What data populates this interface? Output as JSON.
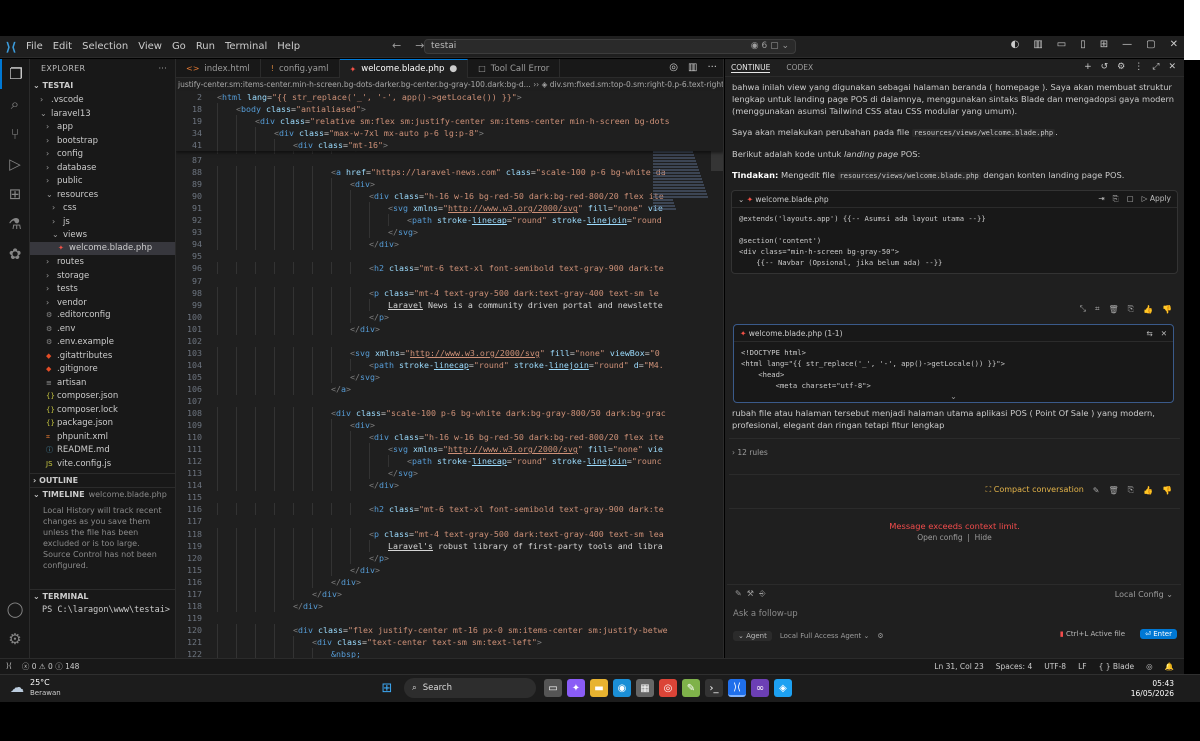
{
  "titlebar": {
    "menu": [
      "File",
      "Edit",
      "Selection",
      "View",
      "Go",
      "Run",
      "Terminal",
      "Help"
    ],
    "search": "testai",
    "badge": "6"
  },
  "sidebar": {
    "header": "EXPLORER",
    "project": "TESTAI",
    "tree": [
      {
        "label": ".vscode",
        "type": "folder",
        "depth": 1,
        "open": false
      },
      {
        "label": "laravel13",
        "type": "folder",
        "depth": 1,
        "open": true
      },
      {
        "label": "app",
        "type": "folder",
        "depth": 2,
        "open": false
      },
      {
        "label": "bootstrap",
        "type": "folder",
        "depth": 2,
        "open": false
      },
      {
        "label": "config",
        "type": "folder",
        "depth": 2,
        "open": false
      },
      {
        "label": "database",
        "type": "folder",
        "depth": 2,
        "open": false
      },
      {
        "label": "public",
        "type": "folder",
        "depth": 2,
        "open": false
      },
      {
        "label": "resources",
        "type": "folder",
        "depth": 2,
        "open": true
      },
      {
        "label": "css",
        "type": "folder",
        "depth": 3,
        "open": false
      },
      {
        "label": "js",
        "type": "folder",
        "depth": 3,
        "open": false
      },
      {
        "label": "views",
        "type": "folder",
        "depth": 3,
        "open": true
      },
      {
        "label": "welcome.blade.php",
        "type": "blade",
        "depth": 4,
        "selected": true
      },
      {
        "label": "routes",
        "type": "folder",
        "depth": 2,
        "open": false
      },
      {
        "label": "storage",
        "type": "folder",
        "depth": 2,
        "open": false
      },
      {
        "label": "tests",
        "type": "folder",
        "depth": 2,
        "open": false
      },
      {
        "label": "vendor",
        "type": "folder",
        "depth": 2,
        "open": false
      },
      {
        "label": ".editorconfig",
        "type": "gear",
        "depth": 2
      },
      {
        "label": ".env",
        "type": "gear",
        "depth": 2
      },
      {
        "label": ".env.example",
        "type": "gear",
        "depth": 2
      },
      {
        "label": ".gitattributes",
        "type": "git",
        "depth": 2
      },
      {
        "label": ".gitignore",
        "type": "git",
        "depth": 2
      },
      {
        "label": "artisan",
        "type": "file",
        "depth": 2
      },
      {
        "label": "composer.json",
        "type": "json",
        "depth": 2
      },
      {
        "label": "composer.lock",
        "type": "json",
        "depth": 2
      },
      {
        "label": "package.json",
        "type": "json",
        "depth": 2
      },
      {
        "label": "phpunit.xml",
        "type": "xml",
        "depth": 2
      },
      {
        "label": "README.md",
        "type": "md",
        "depth": 2
      },
      {
        "label": "vite.config.js",
        "type": "js",
        "depth": 2
      }
    ],
    "outline": "OUTLINE",
    "timeline": "TIMELINE",
    "timeline_file": "welcome.blade.php",
    "timeline_msg": "Local History will track recent changes as you save them unless the file has been excluded or is too large. Source Control has not been configured.",
    "terminal": "TERMINAL",
    "terminal_line": "PS C:\\laragon\\www\\testai>"
  },
  "tabs": [
    {
      "label": "index.html",
      "icon": "<>",
      "color": "#e37933",
      "active": false
    },
    {
      "label": "config.yaml",
      "icon": "!",
      "color": "#cb7e3b",
      "active": false
    },
    {
      "label": "welcome.blade.php",
      "icon": "✦",
      "color": "#f55247",
      "active": true
    },
    {
      "label": "Tool Call Error",
      "icon": "□",
      "color": "#9d9d9d",
      "active": false
    }
  ],
  "breadcrumb_left": "justify-center.sm:items-center.min-h-screen.bg-dots-darker.bg-center.bg-gray-100.dark:bg-d...",
  "breadcrumb_right": "div.sm:fixed.sm:top-0.sm:right-0.p-6.text-right.z-10",
  "sticky": [
    {
      "n": "2",
      "indent": 0,
      "html": "<span class='tg'>&lt;</span><span class='tn'>html</span> <span class='an'>lang</span>=<span class='av'>\"{{ str_replace('_', '-', app()->getLocale()) }}\"</span><span class='tg'>&gt;</span>"
    },
    {
      "n": "18",
      "indent": 1,
      "html": "<span class='tg'>&lt;</span><span class='tn'>body</span> <span class='an'>class</span>=<span class='av'>\"antialiased\"</span><span class='tg'>&gt;</span>"
    },
    {
      "n": "19",
      "indent": 2,
      "html": "<span class='tg'>&lt;</span><span class='tn'>div</span> <span class='an'>class</span>=<span class='av'>\"relative sm:flex sm:justify-center sm:items-center min-h-screen bg-dots</span>"
    },
    {
      "n": "34",
      "indent": 3,
      "html": "<span class='tg'>&lt;</span><span class='tn'>div</span> <span class='an'>class</span>=<span class='av'>\"max-w-7xl mx-auto p-6 lg:p-8\"</span><span class='tg'>&gt;</span>"
    },
    {
      "n": "41",
      "indent": 4,
      "html": "<span class='tg'>&lt;</span><span class='tn'>div</span> <span class='an'>class</span>=<span class='av'>\"mt-16\"</span><span class='tg'>&gt;</span>"
    }
  ],
  "code": [
    {
      "n": "",
      "indent": 7,
      "html": "<span class='fade tg'>&lt;/a&gt;</span>"
    },
    {
      "n": "87",
      "indent": 0,
      "html": ""
    },
    {
      "n": "88",
      "indent": 6,
      "html": "<span class='tg'>&lt;</span><span class='tn'>a</span> <span class='an'>href</span>=<span class='av'>\"https://laravel-news.com\"</span> <span class='an'>class</span>=<span class='av'>\"scale-100 p-6 bg-white da</span>"
    },
    {
      "n": "89",
      "indent": 7,
      "html": "<span class='tg'>&lt;</span><span class='tn'>div</span><span class='tg'>&gt;</span>"
    },
    {
      "n": "90",
      "indent": 8,
      "html": "<span class='tg'>&lt;</span><span class='tn'>div</span> <span class='an'>class</span>=<span class='av'>\"h-16 w-16 bg-red-50 dark:bg-red-800/20 flex ite</span>"
    },
    {
      "n": "91",
      "indent": 9,
      "html": "<span class='tg'>&lt;</span><span class='tn'>svg</span> <span class='an'>xmlns</span>=<span class='av'>\"<u>http://www.w3.org/2000/svg</u>\"</span> <span class='an'>fill</span>=<span class='av'>\"none\"</span> <span class='an'>vie</span>"
    },
    {
      "n": "92",
      "indent": 10,
      "html": "<span class='tg'>&lt;</span><span class='tn'>path</span> <span class='an'>stroke-<u>linecap</u></span>=<span class='av'>\"round\"</span> <span class='an'>stroke-<u>linejoin</u></span>=<span class='av'>\"round</span>"
    },
    {
      "n": "93",
      "indent": 9,
      "html": "<span class='tg'>&lt;/</span><span class='tn'>svg</span><span class='tg'>&gt;</span>"
    },
    {
      "n": "94",
      "indent": 8,
      "html": "<span class='tg'>&lt;/</span><span class='tn'>div</span><span class='tg'>&gt;</span>"
    },
    {
      "n": "95",
      "indent": 0,
      "html": ""
    },
    {
      "n": "96",
      "indent": 8,
      "html": "<span class='tg'>&lt;</span><span class='tn'>h2</span> <span class='an'>class</span>=<span class='av'>\"mt-6 text-xl font-semibold text-gray-900 dark:te</span>"
    },
    {
      "n": "97",
      "indent": 0,
      "html": ""
    },
    {
      "n": "98",
      "indent": 8,
      "html": "<span class='tg'>&lt;</span><span class='tn'>p</span> <span class='an'>class</span>=<span class='av'>\"mt-4 text-gray-500 dark:text-gray-400 text-sm le</span>"
    },
    {
      "n": "99",
      "indent": 9,
      "html": "<span class='tx'><u>Laravel</u> News is a community driven portal and newslette</span>"
    },
    {
      "n": "100",
      "indent": 8,
      "html": "<span class='tg'>&lt;/</span><span class='tn'>p</span><span class='tg'>&gt;</span>"
    },
    {
      "n": "101",
      "indent": 7,
      "html": "<span class='tg'>&lt;/</span><span class='tn'>div</span><span class='tg'>&gt;</span>"
    },
    {
      "n": "102",
      "indent": 0,
      "html": ""
    },
    {
      "n": "103",
      "indent": 7,
      "html": "<span class='tg'>&lt;</span><span class='tn'>svg</span> <span class='an'>xmlns</span>=<span class='av'>\"<u>http://www.w3.org/2000/svg</u>\"</span> <span class='an'>fill</span>=<span class='av'>\"none\"</span> <span class='an'>viewBox</span>=<span class='av'>\"0</span>"
    },
    {
      "n": "104",
      "indent": 8,
      "html": "<span class='tg'>&lt;</span><span class='tn'>path</span> <span class='an'>stroke-<u>linecap</u></span>=<span class='av'>\"round\"</span> <span class='an'>stroke-<u>linejoin</u></span>=<span class='av'>\"round\"</span> <span class='an'>d</span>=<span class='av'>\"M4.</span>"
    },
    {
      "n": "105",
      "indent": 7,
      "html": "<span class='tg'>&lt;/</span><span class='tn'>svg</span><span class='tg'>&gt;</span>"
    },
    {
      "n": "106",
      "indent": 6,
      "html": "<span class='tg'>&lt;/</span><span class='tn'>a</span><span class='tg'>&gt;</span>"
    },
    {
      "n": "107",
      "indent": 0,
      "html": ""
    },
    {
      "n": "108",
      "indent": 6,
      "html": "<span class='tg'>&lt;</span><span class='tn'>div</span> <span class='an'>class</span>=<span class='av'>\"scale-100 p-6 bg-white dark:bg-gray-800/50 dark:bg-grac</span>"
    },
    {
      "n": "109",
      "indent": 7,
      "html": "<span class='tg'>&lt;</span><span class='tn'>div</span><span class='tg'>&gt;</span>"
    },
    {
      "n": "110",
      "indent": 8,
      "html": "<span class='tg'>&lt;</span><span class='tn'>div</span> <span class='an'>class</span>=<span class='av'>\"h-16 w-16 bg-red-50 dark:bg-red-800/20 flex ite</span>"
    },
    {
      "n": "111",
      "indent": 9,
      "html": "<span class='tg'>&lt;</span><span class='tn'>svg</span> <span class='an'>xmlns</span>=<span class='av'>\"<u>http://www.w3.org/2000/svg</u>\"</span> <span class='an'>fill</span>=<span class='av'>\"none\"</span> <span class='an'>vie</span>"
    },
    {
      "n": "112",
      "indent": 10,
      "html": "<span class='tg'>&lt;</span><span class='tn'>path</span> <span class='an'>stroke-<u>linecap</u></span>=<span class='av'>\"round\"</span> <span class='an'>stroke-<u>linejoin</u></span>=<span class='av'>\"rounc</span>"
    },
    {
      "n": "113",
      "indent": 9,
      "html": "<span class='tg'>&lt;/</span><span class='tn'>svg</span><span class='tg'>&gt;</span>"
    },
    {
      "n": "114",
      "indent": 8,
      "html": "<span class='tg'>&lt;/</span><span class='tn'>div</span><span class='tg'>&gt;</span>"
    },
    {
      "n": "115",
      "indent": 0,
      "html": ""
    },
    {
      "n": "116",
      "indent": 8,
      "html": "<span class='tg'>&lt;</span><span class='tn'>h2</span> <span class='an'>class</span>=<span class='av'>\"mt-6 text-xl font-semibold text-gray-900 dark:te</span>"
    },
    {
      "n": "117",
      "indent": 0,
      "html": ""
    },
    {
      "n": "118",
      "indent": 8,
      "html": "<span class='tg'>&lt;</span><span class='tn'>p</span> <span class='an'>class</span>=<span class='av'>\"mt-4 text-gray-500 dark:text-gray-400 text-sm lea</span>"
    },
    {
      "n": "119",
      "indent": 9,
      "html": "<span class='tx'><u>Laravel's</u> robust library of first-party tools and libra</span>"
    },
    {
      "n": "120",
      "indent": 8,
      "html": "<span class='tg'>&lt;/</span><span class='tn'>p</span><span class='tg'>&gt;</span>"
    },
    {
      "n": "115",
      "indent": 7,
      "html": "<span class='tg'>&lt;/</span><span class='tn'>div</span><span class='tg'>&gt;</span>"
    },
    {
      "n": "116",
      "indent": 6,
      "html": "<span class='tg'>&lt;/</span><span class='tn'>div</span><span class='tg'>&gt;</span>"
    },
    {
      "n": "117",
      "indent": 5,
      "html": "<span class='tg'>&lt;/</span><span class='tn'>div</span><span class='tg'>&gt;</span>"
    },
    {
      "n": "118",
      "indent": 4,
      "html": "<span class='tg'>&lt;/</span><span class='tn'>div</span><span class='tg'>&gt;</span>"
    },
    {
      "n": "119",
      "indent": 0,
      "html": ""
    },
    {
      "n": "120",
      "indent": 4,
      "html": "<span class='tg'>&lt;</span><span class='tn'>div</span> <span class='an'>class</span>=<span class='av'>\"flex justify-center mt-16 px-0 sm:items-center sm:justify-betwe</span>"
    },
    {
      "n": "121",
      "indent": 5,
      "html": "<span class='tg'>&lt;</span><span class='tn'>div</span> <span class='an'>class</span>=<span class='av'>\"text-center text-sm sm:text-left\"</span><span class='tg'>&gt;</span>"
    },
    {
      "n": "122",
      "indent": 6,
      "html": "<span class='ent'>&amp;<u>nbsp</u>;</span>"
    },
    {
      "n": "123",
      "indent": 5,
      "html": "<span class='tg'>&lt;/</span><span class='tn'>div</span><span class='tg'>&gt;</span>"
    }
  ],
  "chat": {
    "tabs": [
      "CONTINUE",
      "CODEX"
    ],
    "para1": "bahwa inilah view yang digunakan sebagai halaman beranda ( homepage ). Saya akan membuat struktur lengkap untuk landing page POS di dalamnya, menggunakan sintaks Blade dan mengadopsi gaya modern (menggunakan asumsi Tailwind CSS atau CSS modular yang umum).",
    "para2_pre": "Saya akan melakukan perubahan pada file",
    "para2_code": "resources/views/welcome.blade.php",
    "para2_post": ".",
    "para3_pre": "Berikut adalah kode untuk",
    "para3_em": "landing page",
    "para3_post": "POS:",
    "para4_bold": "Tindakan:",
    "para4_pre": "Mengedit file",
    "para4_code": "resources/views/welcome.blade.php",
    "para4_post": "dengan konten landing page POS.",
    "codeblock1_title": "welcome.blade.php",
    "codeblock1_apply": "Apply",
    "codeblock1_lines": "@extends('layouts.app') {{-- Asumsi ada layout utama --}}\n\n@section('content')\n<div class=\"min-h-screen bg-gray-50\">\n    {{-- Navbar (Opsional, jika belum ada) --}}",
    "user_file": "welcome.blade.php (1-1)",
    "user_code": "<!DOCTYPE html>\n<html lang=\"{{ str_replace('_', '-', app()->getLocale()) }}\">\n    <head>\n        <meta charset=\"utf-8\">",
    "user_msg": "rubah file atau halaman tersebut menjadi halaman utama aplikasi POS ( Point Of Sale ) yang modern, profesional, elegant dan ringan tetapi fitur lengkap",
    "rules": "12 rules",
    "compact": "Compact conversation",
    "error": "Message exceeds context limit.",
    "open_config": "Open config",
    "hide": "Hide",
    "local_config": "Local Config",
    "placeholder": "Ask a follow-up",
    "agent": "Agent",
    "access": "Local Full Access Agent",
    "active_file": "Ctrl+L Active file",
    "enter": "Enter"
  },
  "status": {
    "errors": "0",
    "warnings": "0",
    "info": "148",
    "position": "Ln 31, Col 23",
    "spaces": "Spaces: 4",
    "encoding": "UTF-8",
    "eol": "LF",
    "language": "Blade"
  },
  "taskbar": {
    "temp": "25°C",
    "weather": "Berawan",
    "search": "Search",
    "time": "05:43",
    "date": "16/05/2026"
  }
}
